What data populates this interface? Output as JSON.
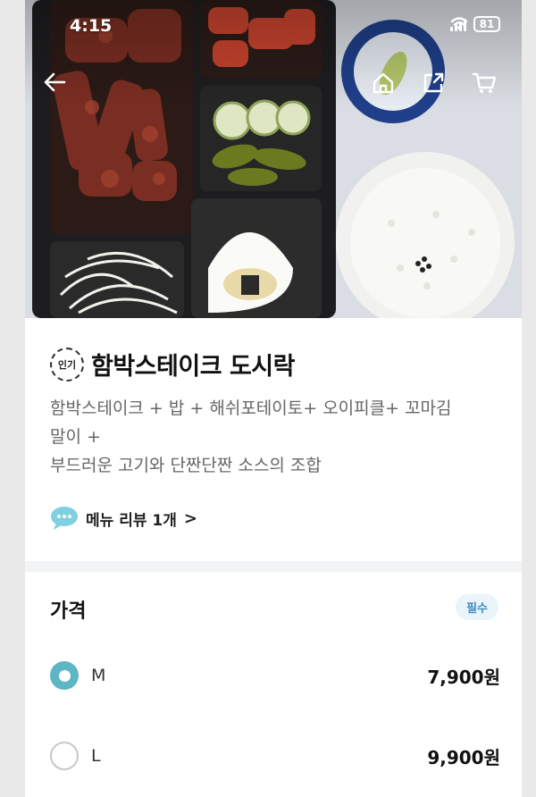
{
  "status_bar": {
    "time": "4:15",
    "battery": "81"
  },
  "product": {
    "badge": "인기",
    "title": "함박스테이크 도시락",
    "description_line1": "함박스테이크 + 밥 + 해쉬포테이토+ 오이피클+ 꼬마김",
    "description_line2": "말이 +",
    "description_line3": "부드러운 고기와 단짠단짠 소스의 조합"
  },
  "review": {
    "label": "메뉴 리뷰 1개",
    "chevron": ">"
  },
  "price_section": {
    "title": "가격",
    "required_label": "필수",
    "options": [
      {
        "name": "M",
        "price": "7,900원",
        "selected": true
      },
      {
        "name": "L",
        "price": "9,900원",
        "selected": false
      }
    ]
  },
  "icons": {
    "back": "arrow-left-icon",
    "home": "home-icon",
    "share": "share-icon",
    "cart": "cart-icon",
    "review": "speech-bubble-icon"
  },
  "colors": {
    "accent": "#5cb6c4",
    "required_bg": "#e9f4fb",
    "required_text": "#3a8fc4"
  }
}
